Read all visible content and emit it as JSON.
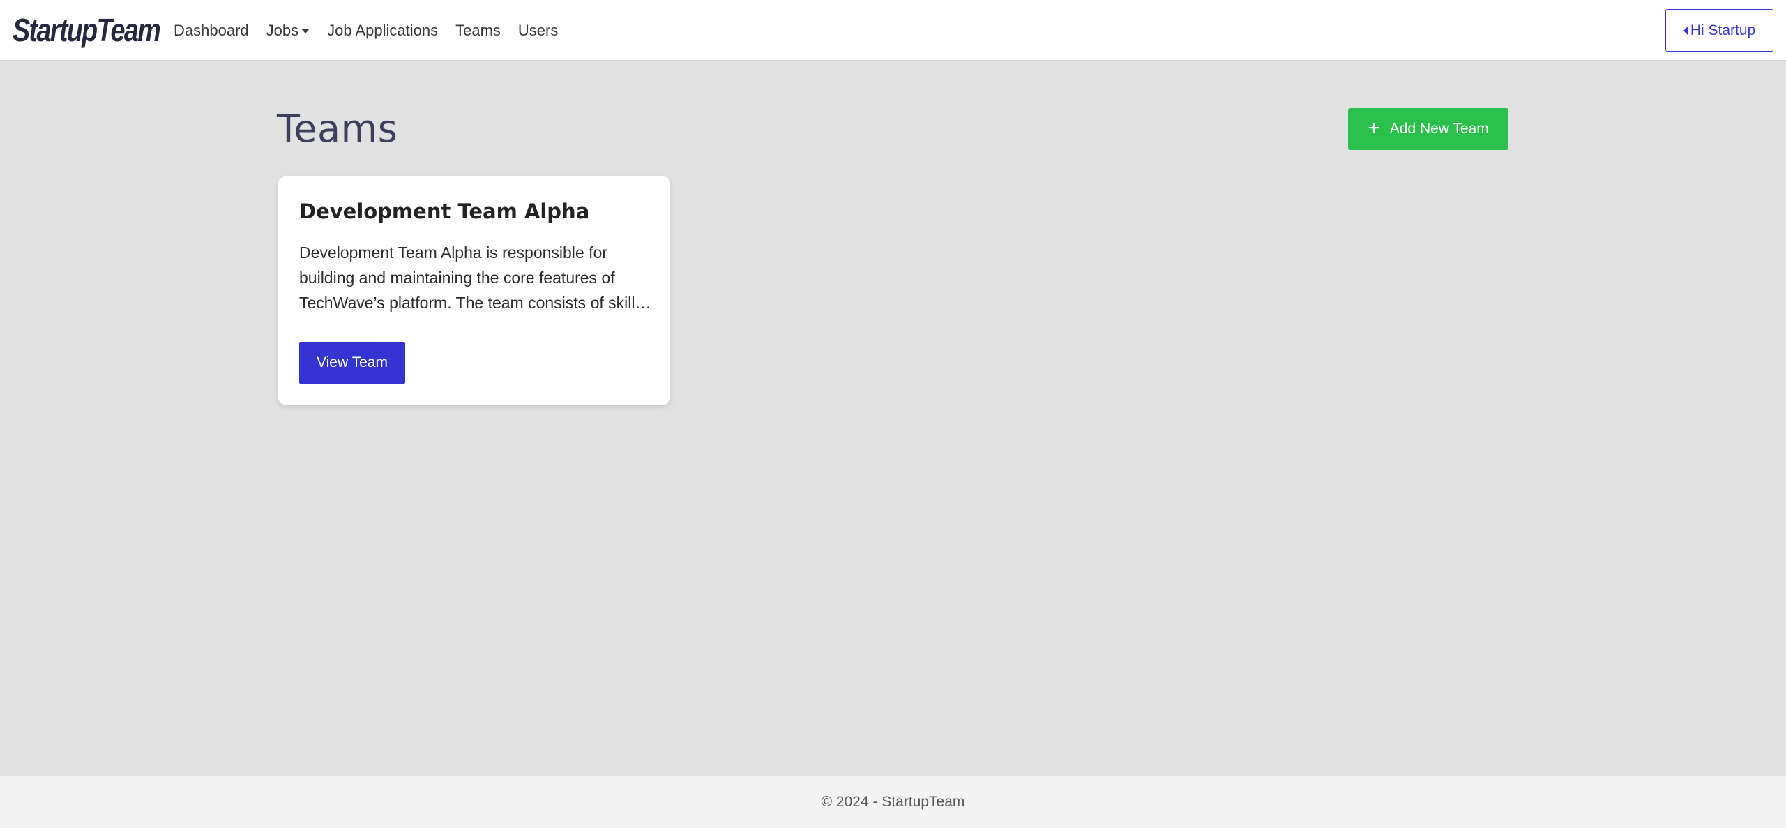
{
  "navbar": {
    "brand": "StartupTeam",
    "links": [
      {
        "label": "Dashboard"
      },
      {
        "label": "Jobs"
      },
      {
        "label": "Job Applications"
      },
      {
        "label": "Teams"
      },
      {
        "label": "Users"
      }
    ],
    "user_button": "Hi Startup"
  },
  "main": {
    "title": "Teams",
    "add_button": "Add New Team",
    "teams": [
      {
        "name": "Development Team Alpha",
        "description": "Development Team Alpha is responsible for building and maintaining the core features of TechWave’s platform. The team consists of skilled developers working across the full stack.",
        "view_button": "View Team"
      }
    ]
  },
  "footer": {
    "text": "© 2024 - StartupTeam"
  },
  "colors": {
    "primary": "#3434d2",
    "success": "#2bbf4c",
    "background": "#e1e1e1",
    "brand": "#25283f"
  },
  "icons": {
    "add": "plus-icon",
    "jobs_dropdown": "caret-down-icon",
    "user_menu": "caret-left-icon"
  }
}
